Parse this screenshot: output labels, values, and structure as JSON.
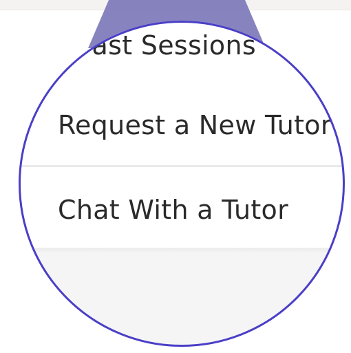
{
  "menu": {
    "items": [
      {
        "label": "Past Sessions"
      },
      {
        "label": "Request a New Tutor"
      },
      {
        "label": "Chat With a Tutor"
      }
    ]
  },
  "colors": {
    "lens_ring": "#4a3fc7",
    "beam": "#7a76b8",
    "text": "#2a2a2a"
  }
}
